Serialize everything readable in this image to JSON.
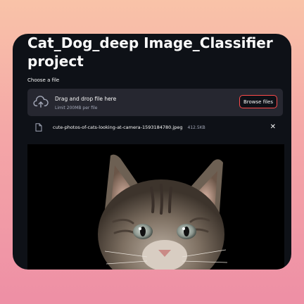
{
  "page": {
    "title": "Cat_Dog_deep Image_Classifier project"
  },
  "uploader": {
    "label": "Choose a file",
    "drop_text": "Drag and drop file here",
    "limit_text": "Limit 200MB per file",
    "browse_label": "Browse files",
    "upload_icon": "cloud-upload-icon"
  },
  "file": {
    "name": "cute-photos-of-cats-looking-at-camera-1593184780.jpeg",
    "size": "412.5KB",
    "file_icon": "file-icon",
    "close_icon": "close-icon",
    "close_glyph": "✕"
  },
  "colors": {
    "window_bg": "#0e1117",
    "panel_bg": "#262730",
    "accent": "#ff4b4b",
    "text": "#fafafa",
    "muted": "#a3a8b8"
  }
}
